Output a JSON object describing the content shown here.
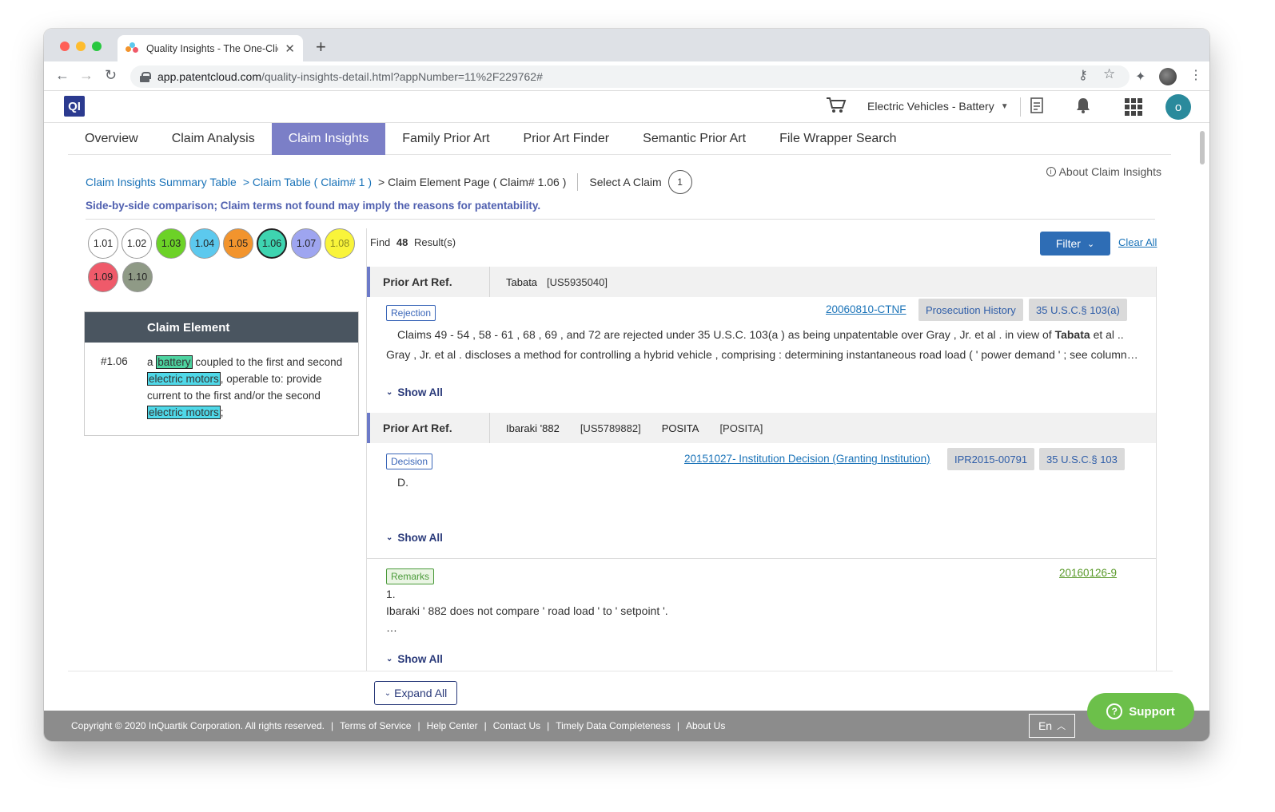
{
  "browser": {
    "tab_title": "Quality Insights - The One-Clic",
    "url_host": "app.patentcloud.com",
    "url_path": "/quality-insights-detail.html?appNumber=11%2F229762#"
  },
  "header": {
    "logo": "QI",
    "workspace": "Electric Vehicles - Battery",
    "user_initial": "o"
  },
  "nav": {
    "tabs": [
      "Overview",
      "Claim Analysis",
      "Claim Insights",
      "Family Prior Art",
      "Prior Art Finder",
      "Semantic Prior Art",
      "File Wrapper Search"
    ],
    "active_index": 2
  },
  "breadcrumb": {
    "summary": "Claim Insights Summary Table",
    "claim_table": "> Claim Table ( Claim# 1 )",
    "current": "> Claim Element Page ( Claim# 1.06 )",
    "select_label": "Select A Claim",
    "select_value": "1"
  },
  "about": "About Claim Insights",
  "subtitle": "Side-by-side comparison; Claim terms not found may imply the reasons for patentability.",
  "elements": [
    {
      "label": "1.01",
      "color": "#ffffff",
      "text": "#222222"
    },
    {
      "label": "1.02",
      "color": "#ffffff",
      "text": "#222222"
    },
    {
      "label": "1.03",
      "color": "#6cd227",
      "text": "#222222"
    },
    {
      "label": "1.04",
      "color": "#5cc9ee",
      "text": "#222222"
    },
    {
      "label": "1.05",
      "color": "#f2942d",
      "text": "#222222"
    },
    {
      "label": "1.06",
      "color": "#3ed4b0",
      "text": "#222222",
      "selected": true
    },
    {
      "label": "1.07",
      "color": "#9ea5f0",
      "text": "#222222"
    },
    {
      "label": "1.08",
      "color": "#f9f43a",
      "text": "#8a8a20"
    },
    {
      "label": "1.09",
      "color": "#ef5a6a",
      "text": "#222222"
    },
    {
      "label": "1.10",
      "color": "#8f9a86",
      "text": "#222222"
    }
  ],
  "claim_element": {
    "header": "Claim Element",
    "number": "#1.06",
    "text": {
      "p1": "a",
      "battery": "battery",
      "p2": "coupled to the first and second",
      "motor1": "electric motors",
      "p3": ", operable to: provide current to the first and/or the second",
      "motor2": "electric motors",
      "p4": ";"
    }
  },
  "find": {
    "prefix": "Find",
    "count": "48",
    "suffix": "Result(s)"
  },
  "filter_label": "Filter",
  "clear_all": "Clear All",
  "results": [
    {
      "ref_label": "Prior Art Ref.",
      "ref_values": [
        "Tabata",
        "[US5935040]"
      ],
      "tag": "Rejection",
      "link": "20060810-CTNF",
      "pills": [
        "Prosecution History",
        "35 U.S.C.§ 103(a)"
      ],
      "line1_a": "Claims 49 - 54 , 58 - 61 , 68 , 69 , and 72 are rejected under 35 U.S.C. 103(a ) as being unpatentable over Gray , Jr. et al . in view of",
      "line1_b": "Tabata",
      "line1_c": "et al ..",
      "line2": "Gray , Jr. et al . discloses a method for controlling a hybrid vehicle , comprising : determining instantaneous road load ( ' power demand ' ; see column…",
      "show_all": "Show All"
    },
    {
      "ref_label": "Prior Art Ref.",
      "ref_values": [
        "Ibaraki '882",
        "[US5789882]",
        "POSITA",
        "[POSITA]"
      ],
      "tag": "Decision",
      "link": "20151027- Institution Decision (Granting Institution)",
      "pills": [
        "IPR2015-00791",
        "35 U.S.C.§ 103"
      ],
      "line1": "D.",
      "show_all": "Show All"
    },
    {
      "tag": "Remarks",
      "link": "20160126-9",
      "lines": [
        "1.",
        "Ibaraki ' 882 does not compare ' road load ' to ' setpoint '.",
        "…"
      ],
      "show_all": "Show All"
    }
  ],
  "expand_all": "Expand All",
  "footer": {
    "items": [
      "Copyright © 2020 InQuartik Corporation. All rights reserved.",
      "Terms of Service",
      "Help Center",
      "Contact Us",
      "Timely Data Completeness",
      "About Us"
    ],
    "lang": "En",
    "support": "Support"
  }
}
